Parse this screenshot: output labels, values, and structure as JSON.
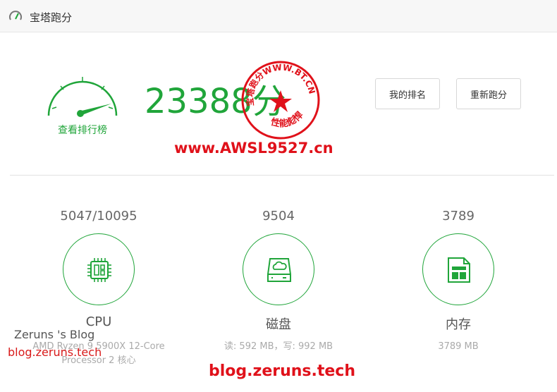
{
  "window": {
    "title": "宝塔跑分",
    "icon": "speedometer-icon"
  },
  "score": {
    "value": "23388",
    "unit": "分",
    "ranking_link": "查看排行榜"
  },
  "stamp": {
    "top_text": "宝塔跑分WWW.BT.CN",
    "bottom_text": "性能彪悍",
    "color": "#e0111a"
  },
  "buttons": {
    "my_ranking": "我的排名",
    "rerun": "重新跑分"
  },
  "watermarks": {
    "site": "www.AWSL9527.cn",
    "blog_title": "Zeruns 's Blog",
    "blog_url_left": "blog.zeruns.tech",
    "blog_url_bottom": "blog.zeruns.tech"
  },
  "metrics": {
    "cpu": {
      "value": "5047/10095",
      "label": "CPU",
      "detail_line1": "AMD Ryzen 9 5900X 12-Core",
      "detail_line2": "Processor 2 核心",
      "icon": "cpu-chip-icon"
    },
    "disk": {
      "value": "9504",
      "label": "磁盘",
      "detail": "读: 592 MB，写: 992 MB",
      "icon": "disk-drive-icon"
    },
    "memory": {
      "value": "3789",
      "label": "内存",
      "detail": "3789 MB",
      "icon": "memory-file-icon"
    }
  },
  "colors": {
    "accent": "#20a53a",
    "watermark_red": "#e0111a"
  }
}
